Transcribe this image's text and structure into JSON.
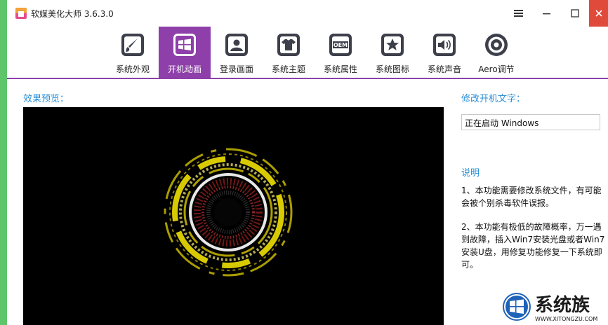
{
  "window": {
    "title": "软媒美化大师 3.6.3.0"
  },
  "toolbar": {
    "items": [
      {
        "label": "系统外观",
        "icon": "paintbrush-icon"
      },
      {
        "label": "开机动画",
        "icon": "windows-logo-icon",
        "active": true
      },
      {
        "label": "登录画面",
        "icon": "user-icon"
      },
      {
        "label": "系统主题",
        "icon": "tshirt-icon"
      },
      {
        "label": "系统属性",
        "icon": "oem-icon"
      },
      {
        "label": "系统图标",
        "icon": "star-icon"
      },
      {
        "label": "系统声音",
        "icon": "speaker-icon"
      },
      {
        "label": "Aero调节",
        "icon": "aero-target-icon"
      }
    ],
    "oem_text": "OEM"
  },
  "preview": {
    "label": "效果预览："
  },
  "boot_text": {
    "label": "修改开机文字：",
    "value": "正在启动 Windows"
  },
  "description": {
    "title": "说明",
    "paragraph1": "1、本功能需要修改系统文件，有可能会被个别杀毒软件误报。",
    "paragraph2": "2、本功能有极低的故障概率，万一遇到故障，插入Win7安装光盘或者Win7安装U盘，用修复功能修复一下系统即可。"
  },
  "watermark": {
    "brand": "系统族",
    "url": "WWW.XITONGZU.COM"
  },
  "colors": {
    "accent": "#8e3fa9",
    "label_blue": "#2a8fd6",
    "close_red": "#e04a3a",
    "desktop_green": "#5fc56b"
  }
}
